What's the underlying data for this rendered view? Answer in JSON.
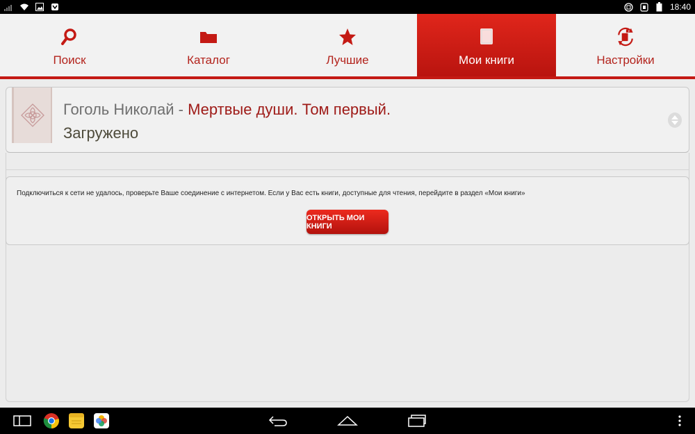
{
  "status_bar": {
    "time": "18:40",
    "left_icons": [
      "signal-icon",
      "wifi-icon",
      "image-icon",
      "download-icon"
    ],
    "right_icons": [
      "sync-icon",
      "battery-saver-icon",
      "battery-icon"
    ]
  },
  "tabs": [
    {
      "label": "Поиск",
      "icon": "search-icon",
      "active": false
    },
    {
      "label": "Каталог",
      "icon": "folder-icon",
      "active": false
    },
    {
      "label": "Лучшие",
      "icon": "star-icon",
      "active": false
    },
    {
      "label": "Мои книги",
      "icon": "book-icon",
      "active": true
    },
    {
      "label": "Настройки",
      "icon": "settings-sync-icon",
      "active": false
    }
  ],
  "book": {
    "author": "Гоголь Николай",
    "separator": " - ",
    "title": "Мертвые души. Том первый.",
    "status": "Загружено"
  },
  "message": {
    "text": "Подключиться к сети не удалось, проверьте Ваше соединение с интернетом. Если у Вас есть книги, доступные для чтения, перейдите в раздел «Мои книги»",
    "button_label": "ОТКРЫТЬ МОИ КНИГИ"
  },
  "colors": {
    "accent": "#c41a14",
    "title_red": "#9e1a17",
    "background": "#ececec"
  },
  "nav_bar": {
    "apps": [
      "recent-apps-icon",
      "chrome-icon",
      "notes-icon",
      "photos-icon"
    ],
    "buttons": [
      "back-icon",
      "home-icon",
      "overview-icon",
      "menu-icon"
    ]
  }
}
